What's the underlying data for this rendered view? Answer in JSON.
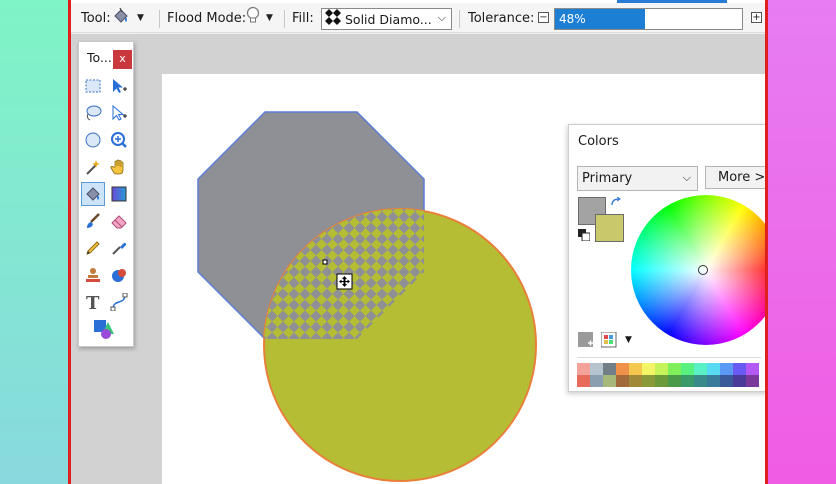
{
  "toolbar": {
    "tool_label": "Tool:",
    "tool_icon": "paint-bucket-icon",
    "flood_mode_label": "Flood Mode:",
    "flood_mode_icon": "bulb-icon",
    "fill_label": "Fill:",
    "fill_value": "Solid Diamo...",
    "fill_icon": "diamond-pattern-icon",
    "tolerance_label": "Tolerance:",
    "tolerance_text": "48%",
    "tolerance_value": 0.48,
    "tolerance_minus": "−",
    "tolerance_plus": "+"
  },
  "tools_window": {
    "title": "To...",
    "close_label": "x",
    "tools": [
      "rectangle-select-icon",
      "move-selection-icon",
      "lasso-select-icon",
      "move-selection-alt-icon",
      "ellipse-select-icon",
      "zoom-icon",
      "magic-wand-icon",
      "pan-icon",
      "paint-bucket-icon",
      "gradient-icon",
      "paintbrush-icon",
      "eraser-icon",
      "pencil-icon",
      "color-picker-icon",
      "clone-stamp-icon",
      "recolor-icon",
      "text-icon",
      "line-curve-icon",
      "shapes-icon"
    ],
    "active_tool": "paint-bucket-icon"
  },
  "colors_window": {
    "title": "Colors",
    "mode": "Primary",
    "more_label": "More >",
    "primary_color": "#a3a3a3",
    "secondary_color": "#c9c96b",
    "palette_top": [
      "#f3a39a",
      "#b6c4cf",
      "#727f86",
      "#f0914a",
      "#f5c74e",
      "#f4f467",
      "#c4f45a",
      "#7ff05a",
      "#58f07f",
      "#58f0c4",
      "#58d9f4",
      "#5a9af4",
      "#6a5af4",
      "#b45af4"
    ],
    "palette_bottom": [
      "#e86a5a",
      "#8aa0b0",
      "#a6b87a",
      "#a06a3a",
      "#a08a3a",
      "#8a9a3a",
      "#6a9a3a",
      "#4a9a4a",
      "#3a9a6a",
      "#3a8a8a",
      "#3a7a9a",
      "#3a5a9a",
      "#4a3a9a",
      "#7a3a9a"
    ]
  },
  "canvas": {
    "octagon_color": "#8f8f96",
    "octagon_outline": "#5b7fd6",
    "circle_color": "#b5bd34",
    "circle_outline": "#e8803a",
    "pattern": "checker-diamond"
  }
}
